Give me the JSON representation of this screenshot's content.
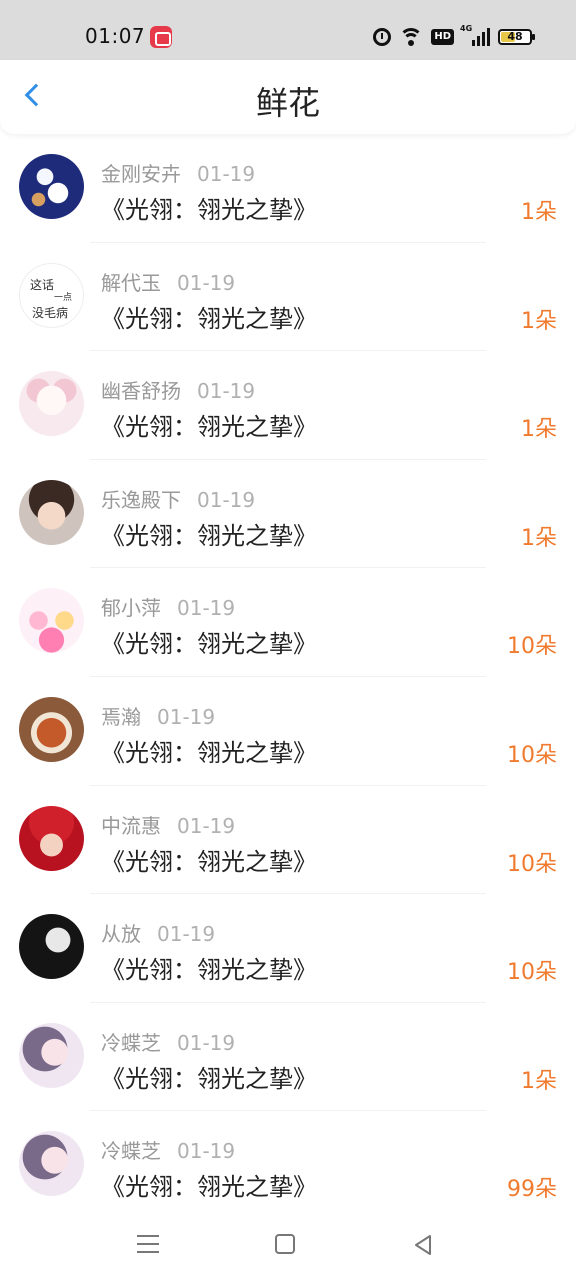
{
  "status_bar": {
    "time": "01:07",
    "network": "4G",
    "hd_label": "HD",
    "battery": "48",
    "battery_level": 0.48
  },
  "header": {
    "title": "鲜花",
    "back_icon": "chevron-left-icon",
    "accent_color": "#2f8fe8"
  },
  "colors": {
    "name_text": "#999999",
    "count_text": "#f07a2d",
    "title_text": "#222222"
  },
  "items": [
    {
      "name": "金刚安卉",
      "date": "01-19",
      "book": "《光翎：翎光之挚》",
      "count": "1朵"
    },
    {
      "name": "解代玉",
      "date": "01-19",
      "book": "《光翎：翎光之挚》",
      "count": "1朵"
    },
    {
      "name": "幽香舒扬",
      "date": "01-19",
      "book": "《光翎：翎光之挚》",
      "count": "1朵"
    },
    {
      "name": "乐逸殿下",
      "date": "01-19",
      "book": "《光翎：翎光之挚》",
      "count": "1朵"
    },
    {
      "name": "郁小萍",
      "date": "01-19",
      "book": "《光翎：翎光之挚》",
      "count": "10朵"
    },
    {
      "name": "焉瀚",
      "date": "01-19",
      "book": "《光翎：翎光之挚》",
      "count": "10朵"
    },
    {
      "name": "中流惠",
      "date": "01-19",
      "book": "《光翎：翎光之挚》",
      "count": "10朵"
    },
    {
      "name": "从放",
      "date": "01-19",
      "book": "《光翎：翎光之挚》",
      "count": "10朵"
    },
    {
      "name": "冷蝶芝",
      "date": "01-19",
      "book": "《光翎：翎光之挚》",
      "count": "1朵"
    },
    {
      "name": "冷蝶芝",
      "date": "01-19",
      "book": "《光翎：翎光之挚》",
      "count": "99朵"
    }
  ],
  "avatar_text": {
    "line1": "这话",
    "line2": "一点",
    "line3": "没毛病"
  },
  "nav": {
    "menu_icon": "menu-icon",
    "home_icon": "home-square-icon",
    "back_icon": "back-triangle-icon"
  }
}
